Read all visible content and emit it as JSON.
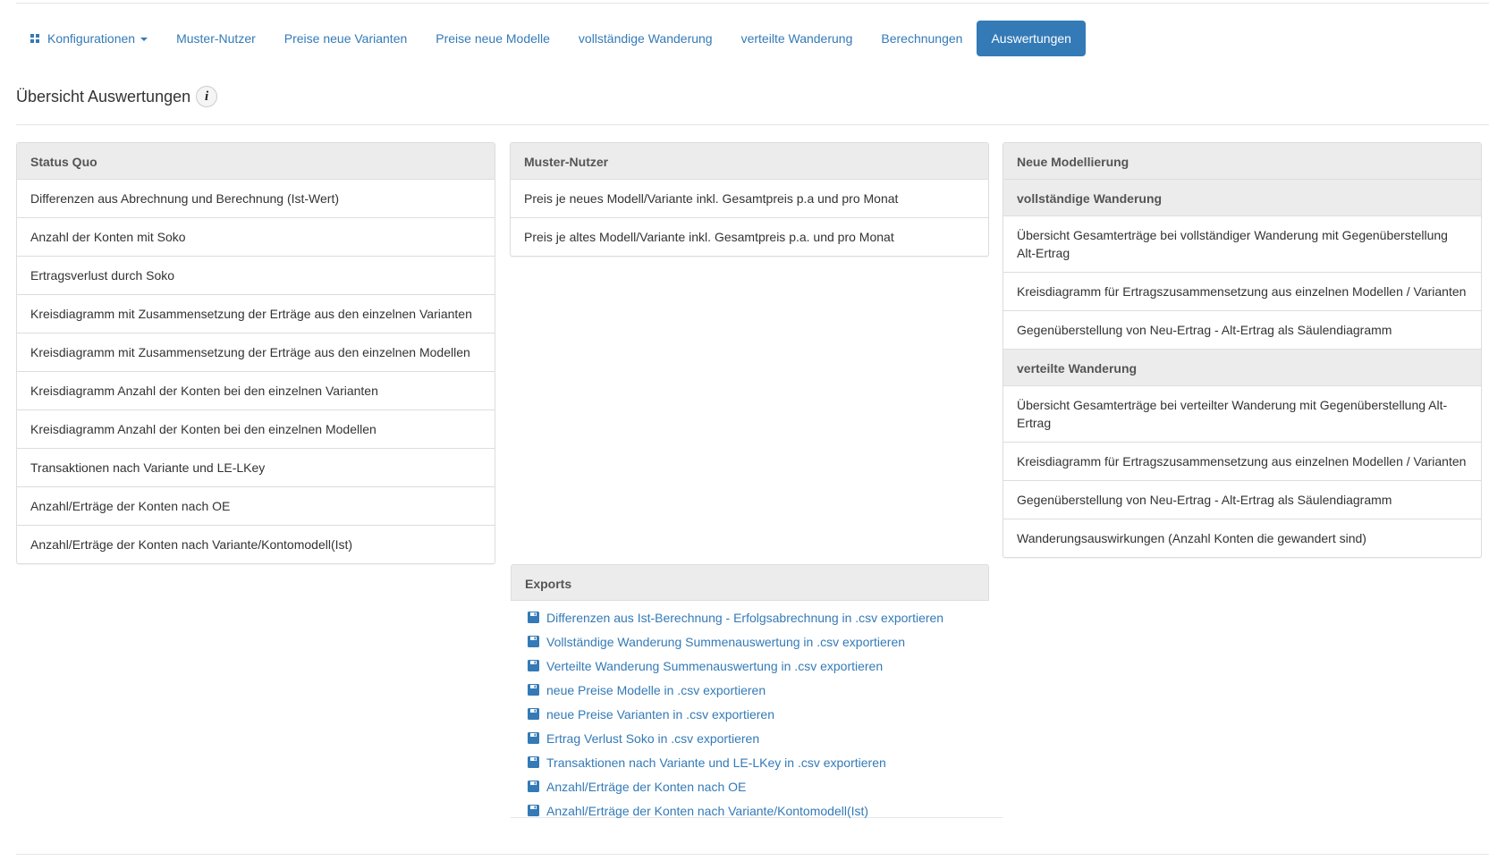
{
  "nav": {
    "config_label": "Konfigurationen",
    "items": [
      "Muster-Nutzer",
      "Preise neue Varianten",
      "Preise neue Modelle",
      "vollständige Wanderung",
      "verteilte Wanderung",
      "Berechnungen",
      "Auswertungen"
    ],
    "active": "Auswertungen"
  },
  "page": {
    "title": "Übersicht Auswertungen",
    "info": "i"
  },
  "status_quo": {
    "heading": "Status Quo",
    "items": [
      "Differenzen aus Abrechnung und Berechnung (Ist-Wert)",
      "Anzahl der Konten mit Soko",
      "Ertragsverlust durch Soko",
      "Kreisdiagramm mit Zusammensetzung der Erträge aus den einzelnen Varianten",
      "Kreisdiagramm mit Zusammensetzung der Erträge aus den einzelnen Modellen",
      "Kreisdiagramm Anzahl der Konten bei den einzelnen Varianten",
      "Kreisdiagramm Anzahl der Konten bei den einzelnen Modellen",
      "Transaktionen nach Variante und LE-LKey",
      "Anzahl/Erträge der Konten nach OE",
      "Anzahl/Erträge der Konten nach Variante/Kontomodell(Ist)"
    ]
  },
  "muster_nutzer": {
    "heading": "Muster-Nutzer",
    "items": [
      "Preis je neues Modell/Variante inkl. Gesamtpreis p.a und pro Monat",
      "Preis je altes Modell/Variante inkl. Gesamtpreis p.a. und pro Monat"
    ]
  },
  "neue_modellierung": {
    "heading": "Neue Modellierung",
    "sub1": {
      "heading": "vollständige Wanderung",
      "items": [
        "Übersicht Gesamterträge bei vollständiger Wanderung mit Gegenüberstellung Alt-Ertrag",
        "Kreisdiagramm für Ertragszusammensetzung aus einzelnen Modellen / Varianten",
        "Gegenüberstellung von Neu-Ertrag - Alt-Ertrag als Säulendiagramm"
      ]
    },
    "sub2": {
      "heading": "verteilte Wanderung",
      "items": [
        "Übersicht Gesamterträge bei verteilter Wanderung mit Gegenüberstellung Alt-Ertrag",
        "Kreisdiagramm für Ertragszusammensetzung aus einzelnen Modellen / Varianten",
        "Gegenüberstellung von Neu-Ertrag - Alt-Ertrag als Säulendiagramm",
        "Wanderungsauswirkungen (Anzahl Konten die gewandert sind)"
      ]
    }
  },
  "exports": {
    "heading": "Exports",
    "items": [
      "Differenzen aus Ist-Berechnung - Erfolgsabrechnung in .csv exportieren",
      "Vollständige Wanderung Summenauswertung in .csv exportieren",
      "Verteilte Wanderung Summenauswertung in .csv exportieren",
      "neue Preise Modelle in .csv exportieren",
      "neue Preise Varianten in .csv exportieren",
      "Ertrag Verlust Soko in .csv exportieren",
      "Transaktionen nach Variante und LE-LKey in .csv exportieren",
      "Anzahl/Erträge der Konten nach OE",
      "Anzahl/Erträge der Konten nach Variante/Kontomodell(Ist)"
    ],
    "icon": "floppy-disk-icon"
  },
  "colors": {
    "link": "#337ab7",
    "active_bg": "#337ab7",
    "panel_head": "#ececec"
  }
}
